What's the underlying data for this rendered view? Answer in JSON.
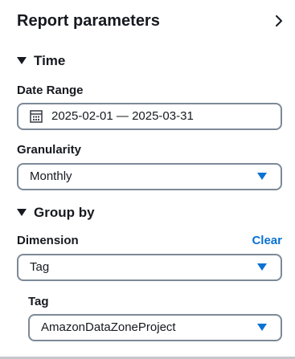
{
  "header": {
    "title": "Report parameters",
    "chevron_icon": "chevron-right-icon"
  },
  "time_section": {
    "title": "Time",
    "expanded": true,
    "date_range": {
      "label": "Date Range",
      "value": "2025-02-01 — 2025-03-31",
      "icon": "calendar-icon"
    },
    "granularity": {
      "label": "Granularity",
      "value": "Monthly"
    }
  },
  "group_section": {
    "title": "Group by",
    "expanded": true,
    "dimension": {
      "label": "Dimension",
      "clear_label": "Clear",
      "value": "Tag"
    },
    "tag": {
      "label": "Tag",
      "value": "AmazonDataZoneProject"
    }
  },
  "colors": {
    "accent": "#0972d3",
    "text": "#16191f",
    "border": "#7d8998"
  }
}
